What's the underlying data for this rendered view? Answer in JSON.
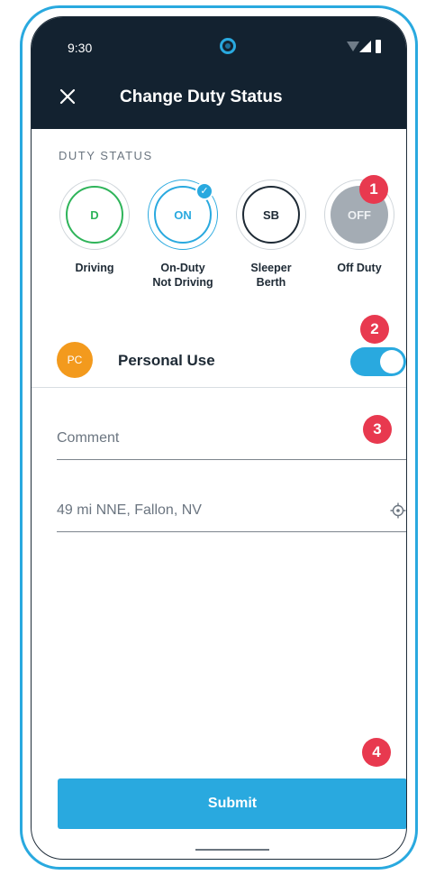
{
  "status_bar": {
    "time": "9:30"
  },
  "header": {
    "title": "Change Duty Status"
  },
  "duty_status": {
    "section_label": "DUTY STATUS",
    "options": [
      {
        "code": "D",
        "label_line1": "Driving",
        "label_line2": ""
      },
      {
        "code": "ON",
        "label_line1": "On-Duty",
        "label_line2": "Not Driving"
      },
      {
        "code": "SB",
        "label_line1": "Sleeper",
        "label_line2": "Berth"
      },
      {
        "code": "OFF",
        "label_line1": "Off Duty",
        "label_line2": ""
      }
    ],
    "selected": "ON"
  },
  "personal_use": {
    "avatar_text": "PC",
    "label": "Personal Use",
    "enabled": true
  },
  "comment": {
    "placeholder": "Comment"
  },
  "location": {
    "value": "49 mi NNE, Fallon, NV"
  },
  "submit": {
    "label": "Submit"
  },
  "callouts": [
    "1",
    "2",
    "3",
    "4"
  ],
  "colors": {
    "accent": "#29a9df",
    "header_bg": "#132230",
    "callout": "#e8394f",
    "driving": "#2fb45a",
    "pc_avatar": "#f39a1d"
  }
}
